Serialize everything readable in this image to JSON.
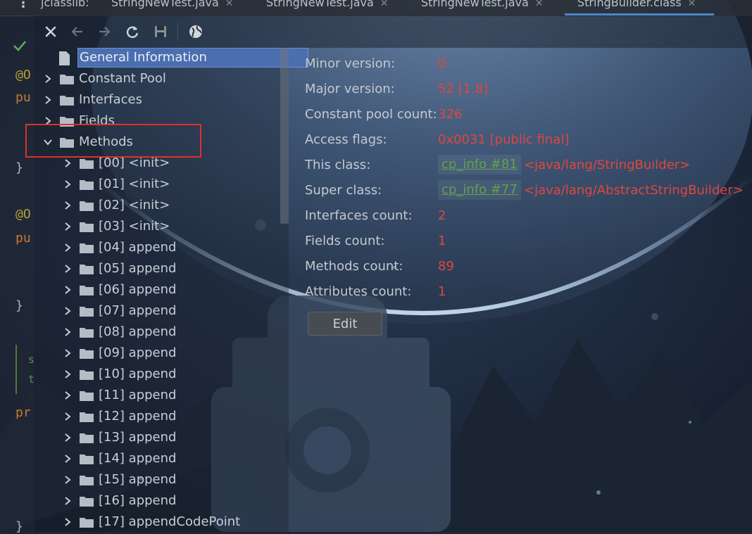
{
  "tabs": [
    {
      "label": "jclasslib:",
      "close": ""
    },
    {
      "label": "StringNewTest.java",
      "close": "✕"
    },
    {
      "label": "StringNewTest.java",
      "close": "✕"
    },
    {
      "label": "StringNewTest.java",
      "close": "✕"
    },
    {
      "label": "StringBuilder.class",
      "close": "✕"
    }
  ],
  "gutter": {
    "ann1": "@O",
    "kw1": "pu",
    "brace1": "}",
    "ann2": "@O",
    "kw2": "pu",
    "brace2": "}",
    "g1": "s",
    "g2": "t",
    "kw3": "pr",
    "brace3": "}"
  },
  "toolbar": {
    "close_icon": "close-icon",
    "back_icon": "arrow-left-icon",
    "forward_icon": "arrow-right-icon",
    "refresh_icon": "refresh-icon",
    "save_icon": "save-icon",
    "browser_icon": "globe-icon"
  },
  "tree": {
    "general": "General Information",
    "top_items": [
      "Constant Pool",
      "Interfaces",
      "Fields",
      "Methods"
    ],
    "methods": [
      "[00] <init>",
      "[01] <init>",
      "[02] <init>",
      "[03] <init>",
      "[04] append",
      "[05] append",
      "[06] append",
      "[07] append",
      "[08] append",
      "[09] append",
      "[10] append",
      "[11] append",
      "[12] append",
      "[13] append",
      "[14] append",
      "[15] append",
      "[16] append",
      "[17] appendCodePoint"
    ]
  },
  "info": {
    "minor_version": {
      "label": "Minor version:",
      "value": "0"
    },
    "major_version": {
      "label": "Major version:",
      "value": "52 [1.8]"
    },
    "cp_count": {
      "label": "Constant pool count:",
      "value": "326"
    },
    "access_flags": {
      "label": "Access flags:",
      "value": "0x0031 [public final]"
    },
    "this_class": {
      "label": "This class:",
      "link": "cp_info #81",
      "desc": "<java/lang/StringBuilder>"
    },
    "super_class": {
      "label": "Super class:",
      "link": "cp_info #77",
      "desc": "<java/lang/AbstractStringBuilder>"
    },
    "interfaces_count": {
      "label": "Interfaces count:",
      "value": "2"
    },
    "fields_count": {
      "label": "Fields count:",
      "value": "1"
    },
    "methods_count": {
      "label": "Methods count:",
      "value": "89"
    },
    "attributes_count": {
      "label": "Attributes count:",
      "value": "1"
    },
    "edit_label": "Edit"
  },
  "colors": {
    "value_red": "#e0463e",
    "link_green": "#5fa24b",
    "selection_blue": "#4b6eaf",
    "highlight_red": "#e0302a"
  }
}
